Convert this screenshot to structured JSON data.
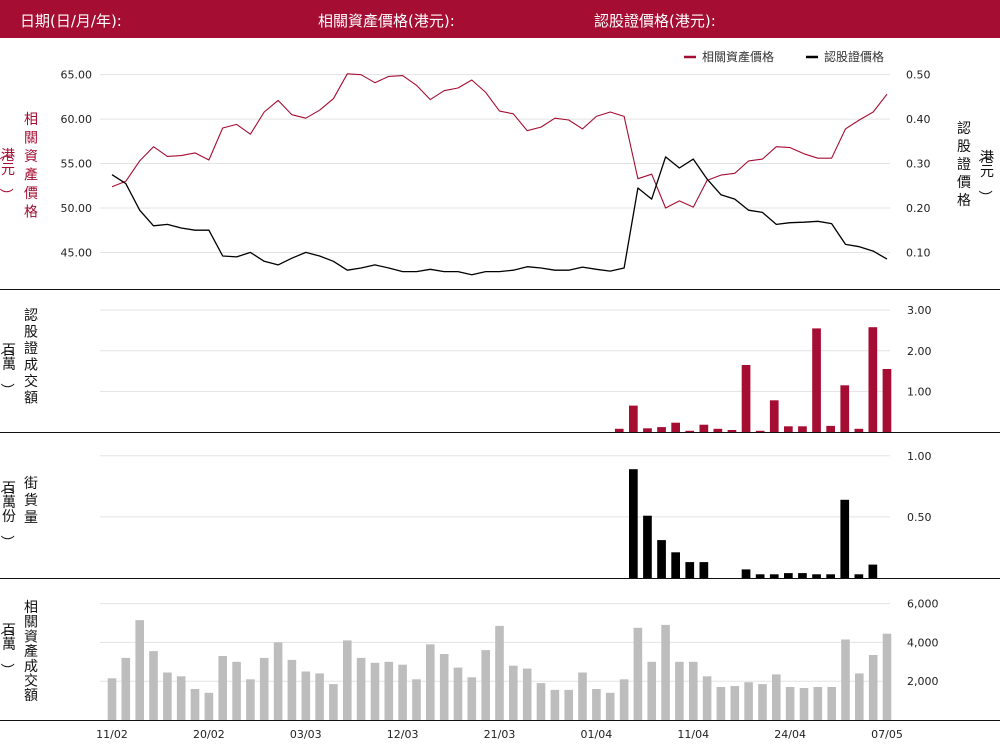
{
  "header": {
    "date_label": "日期(日/月/年):",
    "underlying_label": "相關資產價格(港元):",
    "warrant_label": "認股證價格(港元):"
  },
  "legend": {
    "underlying": "相關資產價格",
    "warrant": "認股證價格"
  },
  "axis_labels": {
    "underlying_price": "相關資產價格",
    "underlying_price_unit": "（港元）",
    "warrant_price": "認股證價格",
    "warrant_price_unit": "（港元）",
    "warrant_turnover": "認股證成交額",
    "warrant_turnover_unit": "（百萬）",
    "outstanding": "街貨量",
    "outstanding_unit": "（百萬份）",
    "underlying_turnover": "相關資產成交額",
    "underlying_turnover_unit": "（百萬）"
  },
  "colors": {
    "brand": "#a50d32",
    "underlying_line": "#a50d32",
    "warrant_line": "#000000",
    "warrant_turnover_bar": "#a50d32",
    "outstanding_bar": "#000000",
    "underlying_turnover_bar": "#bdbdbd"
  },
  "chart_data": [
    {
      "type": "line",
      "x_tick_labels": [
        "11/02",
        "20/02",
        "03/03",
        "12/03",
        "21/03",
        "01/04",
        "11/04",
        "24/04",
        "07/05"
      ],
      "series": [
        {
          "name": "相關資產價格",
          "axis": "left",
          "values": [
            52.4,
            53.0,
            55.3,
            56.9,
            55.8,
            55.9,
            56.2,
            55.4,
            59.0,
            59.4,
            58.3,
            60.8,
            62.1,
            60.5,
            60.1,
            61.0,
            62.3,
            65.1,
            65.0,
            64.1,
            64.8,
            64.9,
            63.8,
            62.2,
            63.2,
            63.5,
            64.4,
            63.0,
            60.9,
            60.6,
            58.7,
            59.1,
            60.1,
            59.9,
            58.9,
            60.3,
            60.8,
            60.3,
            53.3,
            53.8,
            50.0,
            50.8,
            50.1,
            53.1,
            53.7,
            53.9,
            55.3,
            55.5,
            56.9,
            56.8,
            56.1,
            55.6,
            55.6,
            58.9,
            59.9,
            60.8,
            62.8
          ]
        },
        {
          "name": "認股證價格",
          "axis": "right",
          "values": [
            0.275,
            0.255,
            0.195,
            0.16,
            0.163,
            0.155,
            0.15,
            0.15,
            0.092,
            0.09,
            0.1,
            0.08,
            0.072,
            0.087,
            0.1,
            0.092,
            0.08,
            0.06,
            0.065,
            0.072,
            0.065,
            0.057,
            0.057,
            0.062,
            0.057,
            0.057,
            0.05,
            0.057,
            0.057,
            0.06,
            0.068,
            0.065,
            0.06,
            0.06,
            0.067,
            0.062,
            0.058,
            0.065,
            0.245,
            0.22,
            0.315,
            0.29,
            0.31,
            0.265,
            0.23,
            0.22,
            0.195,
            0.19,
            0.163,
            0.167,
            0.168,
            0.17,
            0.165,
            0.118,
            0.113,
            0.103,
            0.085
          ]
        }
      ],
      "left_axis_ticks": [
        45,
        50,
        55,
        60,
        65
      ],
      "left_axis_tick_labels": [
        "45.00",
        "50.00",
        "55.00",
        "60.00",
        "65.00"
      ],
      "right_axis_ticks": [
        0.1,
        0.2,
        0.3,
        0.4,
        0.5
      ],
      "right_axis_tick_labels": [
        "0.10",
        "0.20",
        "0.30",
        "0.40",
        "0.50"
      ],
      "left_ylim": [
        41,
        68
      ],
      "right_ylim": [
        0.02,
        0.56
      ],
      "legend_position": "top-right",
      "grid": true
    },
    {
      "type": "bar",
      "name": "認股證成交額",
      "values": [
        0,
        0,
        0,
        0,
        0,
        0,
        0,
        0,
        0,
        0,
        0,
        0,
        0,
        0,
        0,
        0,
        0,
        0,
        0,
        0,
        0,
        0,
        0,
        0,
        0,
        0,
        0,
        0,
        0,
        0,
        0,
        0,
        0,
        0,
        0,
        0,
        0.08,
        0.65,
        0.09,
        0.12,
        0.23,
        0.03,
        0.18,
        0.08,
        0.05,
        1.65,
        0.03,
        0.78,
        0.14,
        0.14,
        2.55,
        0.15,
        1.15,
        0.08,
        2.58,
        1.55
      ],
      "y_ticks": [
        1,
        2,
        3
      ],
      "y_tick_labels": [
        "1.00",
        "2.00",
        "3.00"
      ],
      "ylim": [
        0,
        3.25
      ],
      "grid": true
    },
    {
      "type": "bar",
      "name": "街貨量",
      "values": [
        0,
        0,
        0,
        0,
        0,
        0,
        0,
        0,
        0,
        0,
        0,
        0,
        0,
        0,
        0,
        0,
        0,
        0,
        0,
        0,
        0,
        0,
        0,
        0,
        0,
        0,
        0,
        0,
        0,
        0,
        0,
        0,
        0,
        0,
        0,
        0,
        0,
        0.89,
        0.51,
        0.31,
        0.21,
        0.13,
        0.13,
        0,
        0,
        0.07,
        0.03,
        0.03,
        0.04,
        0.04,
        0.03,
        0.03,
        0.64,
        0.03,
        0.11,
        0
      ],
      "y_ticks": [
        0.5,
        1
      ],
      "y_tick_labels": [
        "0.50",
        "1.00"
      ],
      "ylim": [
        0,
        1.08
      ],
      "grid": true
    },
    {
      "type": "bar",
      "name": "相關資產成交額",
      "values": [
        2150,
        3200,
        5150,
        3550,
        2450,
        2250,
        1600,
        1400,
        3300,
        3000,
        2100,
        3200,
        4000,
        3100,
        2500,
        2400,
        1850,
        4100,
        3200,
        2950,
        3000,
        2850,
        2100,
        3900,
        3400,
        2700,
        2200,
        3600,
        4850,
        2800,
        2650,
        1900,
        1550,
        1550,
        2450,
        1600,
        1400,
        2100,
        4750,
        3000,
        4900,
        3000,
        3000,
        2250,
        1700,
        1750,
        1950,
        1850,
        2350,
        1700,
        1650,
        1700,
        1700,
        4150,
        2400,
        3350,
        4450
      ],
      "y_ticks": [
        2000,
        4000,
        6000
      ],
      "y_tick_labels": [
        "2,000",
        "4,000",
        "6,000"
      ],
      "ylim": [
        0,
        6700
      ],
      "grid": true
    }
  ]
}
